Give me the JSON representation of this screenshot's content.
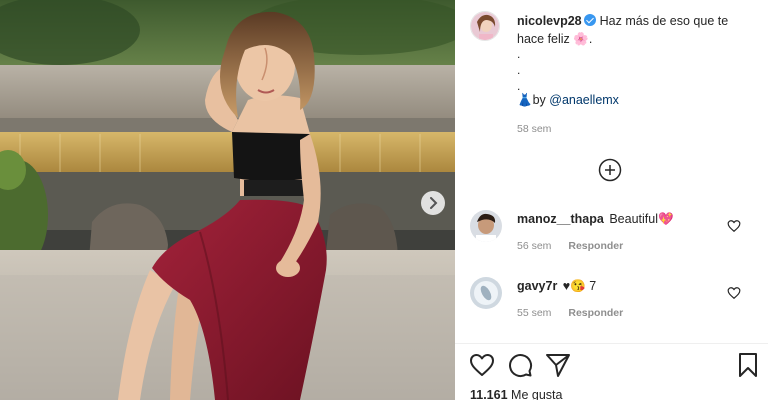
{
  "post": {
    "photo_alt_icon": "next-arrow-icon",
    "author": {
      "username": "nicolevp28",
      "verified": true
    },
    "caption": {
      "text": "Haz más de eso que te hace feliz 🌸.",
      "dots": [
        ".",
        ".",
        "."
      ],
      "credit_prefix": "👗by",
      "credit_mention": "@anaellemx",
      "time": "58 sem"
    },
    "load_more_icon": "plus-circle-icon",
    "comments": [
      {
        "username": "manoz__thapa",
        "text": "Beautiful💖",
        "time": "56 sem",
        "reply_label": "Responder"
      },
      {
        "username": "gavy7r",
        "text": "♥😘 7",
        "time": "55 sem",
        "reply_label": "Responder"
      }
    ],
    "actions": {
      "like_icon": "heart-icon",
      "comment_icon": "comment-bubble-icon",
      "share_icon": "paper-plane-icon",
      "save_icon": "bookmark-icon"
    },
    "likes": {
      "count": "11.161",
      "label": "Me gusta"
    }
  },
  "colors": {
    "verified": "#3897f0",
    "mention": "#00376b",
    "muted": "#8e8e8e",
    "skirt": "#8e1a2e",
    "top": "#141414"
  }
}
